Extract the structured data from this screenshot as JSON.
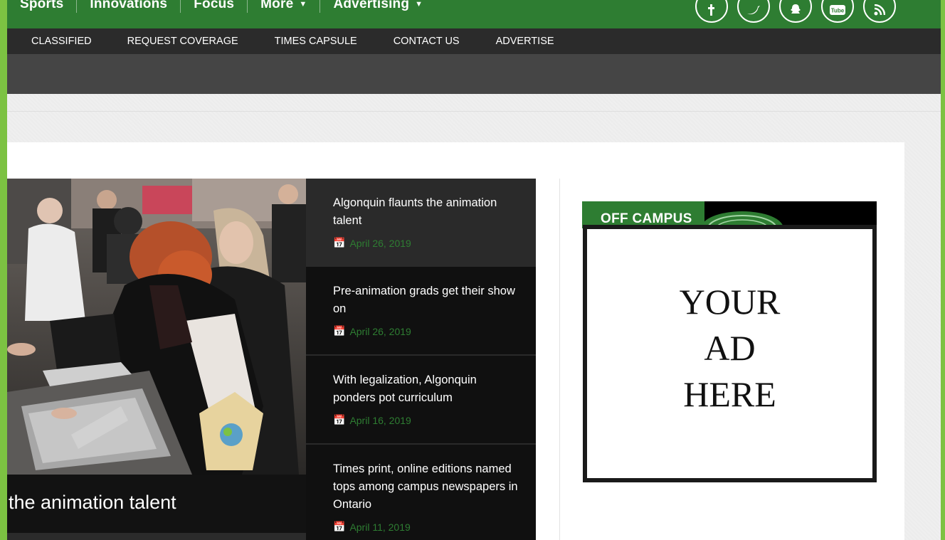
{
  "topnav": {
    "items": [
      {
        "label": "Sports",
        "dropdown": false
      },
      {
        "label": "Innovations",
        "dropdown": false
      },
      {
        "label": "Focus",
        "dropdown": false
      },
      {
        "label": "More",
        "dropdown": true
      },
      {
        "label": "Advertising",
        "dropdown": true
      }
    ],
    "social_icons": [
      "facebook-icon",
      "twitter-icon",
      "snapchat-icon",
      "youtube-icon",
      "rss-icon"
    ],
    "youtube_glyph": "Tube"
  },
  "subnav": {
    "items": [
      "CLASSIFIED",
      "REQUEST COVERAGE",
      "TIMES CAPSULE",
      "CONTACT US",
      "ADVERTISE"
    ]
  },
  "featured": {
    "caption": "the animation talent"
  },
  "articles": [
    {
      "title": "Algonquin flaunts the animation talent",
      "date": "April 26, 2019",
      "active": true
    },
    {
      "title": "Pre-animation grads get their show on",
      "date": "April 26, 2019",
      "active": false
    },
    {
      "title": "With legalization, Algonquin ponders pot curriculum",
      "date": "April 16, 2019",
      "active": false
    },
    {
      "title": "Times print, online editions named tops among campus newspapers in Ontario",
      "date": "April 11, 2019",
      "active": false
    }
  ],
  "ad": {
    "label": "OFF CAMPUS",
    "line1": "YOUR",
    "line2": "AD",
    "line3": "HERE"
  },
  "colors": {
    "brand_green": "#2e7d32",
    "border_green": "#7cc242",
    "nav_dark": "#2b2b2b"
  }
}
